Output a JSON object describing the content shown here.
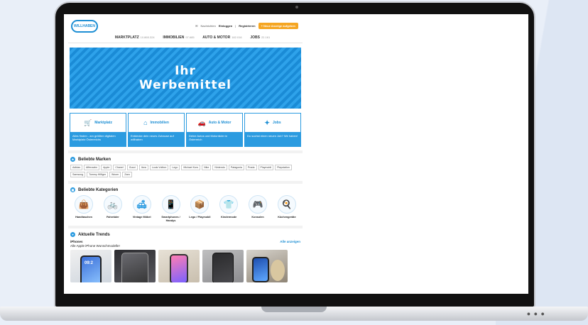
{
  "header": {
    "logo_text": "WILLHABEN",
    "messages": "Nachrichten",
    "login": "Einloggen",
    "divider": "|",
    "register": "Registrieren",
    "new_ad": "+ Neue Anzeige aufgeben"
  },
  "nav": [
    {
      "label": "MARKTPLATZ",
      "count": "10.865.324"
    },
    {
      "label": "IMMOBILIEN",
      "count": "97.685"
    },
    {
      "label": "AUTO & MOTOR",
      "count": "182.016"
    },
    {
      "label": "JOBS",
      "count": "22.161"
    }
  ],
  "banner": {
    "line1": "Ihr",
    "line2": "Werbemittel"
  },
  "categories": [
    {
      "title": "Marktplatz",
      "desc": "Alles finden - am größten digitalen Marktplatz Österreichs",
      "icon": "shop-icon"
    },
    {
      "title": "Immobilien",
      "desc": "Entdecke dein neues Zuhause auf willhaben",
      "icon": "house-icon"
    },
    {
      "title": "Auto & Motor",
      "desc": "Deine Autos und Motorräder in Österreich",
      "icon": "car-icon"
    },
    {
      "title": "Jobs",
      "desc": "Du suchst einen neuen Job? Wir haben!",
      "icon": "jobs-icon"
    }
  ],
  "brands": {
    "title": "Beliebte Marken",
    "items": [
      "Adidas",
      "Affenzahn",
      "Apple",
      "Chanel",
      "Gucci",
      "Ikea",
      "Louis Vuitton",
      "Lego",
      "Michael Kors",
      "Nike",
      "Nintendo",
      "Patagonia",
      "Prada",
      "Playmobil",
      "Playstation",
      "Samsung",
      "Tommy Hilfiger",
      "Woom",
      "Zara"
    ]
  },
  "kategorien": {
    "title": "Beliebte Kategorien",
    "items": [
      {
        "label": "Handtaschen",
        "icon": "handbag-icon"
      },
      {
        "label": "Fahrräder",
        "icon": "bicycle-icon"
      },
      {
        "label": "Vintage Möbel",
        "icon": "sofa-icon"
      },
      {
        "label": "Smartphones / Handys",
        "icon": "phone-icon"
      },
      {
        "label": "Lego / Playmobil",
        "icon": "box-icon"
      },
      {
        "label": "Kindermode",
        "icon": "overalls-icon"
      },
      {
        "label": "Konsolen",
        "icon": "gamepad-icon"
      },
      {
        "label": "Küchengeräte",
        "icon": "appliance-icon"
      }
    ]
  },
  "trends": {
    "title": "Aktuelle Trends",
    "row_title": "iPhones",
    "show_all": "Alle anzeigen",
    "subtitle": "Alle Apple iPhone Wunschmodelle!",
    "first_photo_time": "09:2"
  }
}
